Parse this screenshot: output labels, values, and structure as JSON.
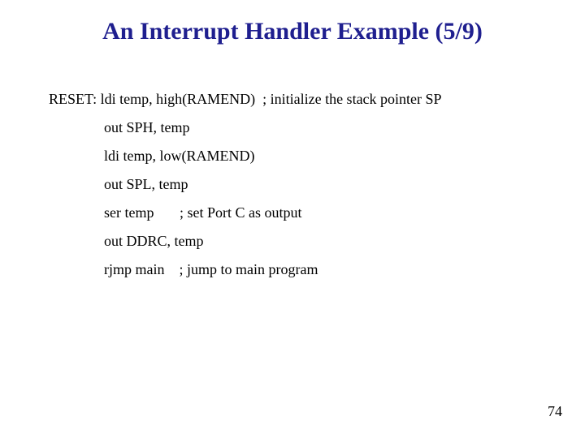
{
  "title": "An Interrupt Handler Example (5/9)",
  "lines": {
    "l1_label": "RESET: ",
    "l1_rest": "ldi temp, high(RAMEND)  ; initialize the stack pointer SP",
    "l2": "out SPH, temp",
    "l3": "ldi temp, low(RAMEND)",
    "l4": "out SPL, temp",
    "l5": "ser temp       ; set Port C as output",
    "l6": "out DDRC, temp",
    "l7": "rjmp main    ; jump to main program"
  },
  "page_number": "74"
}
